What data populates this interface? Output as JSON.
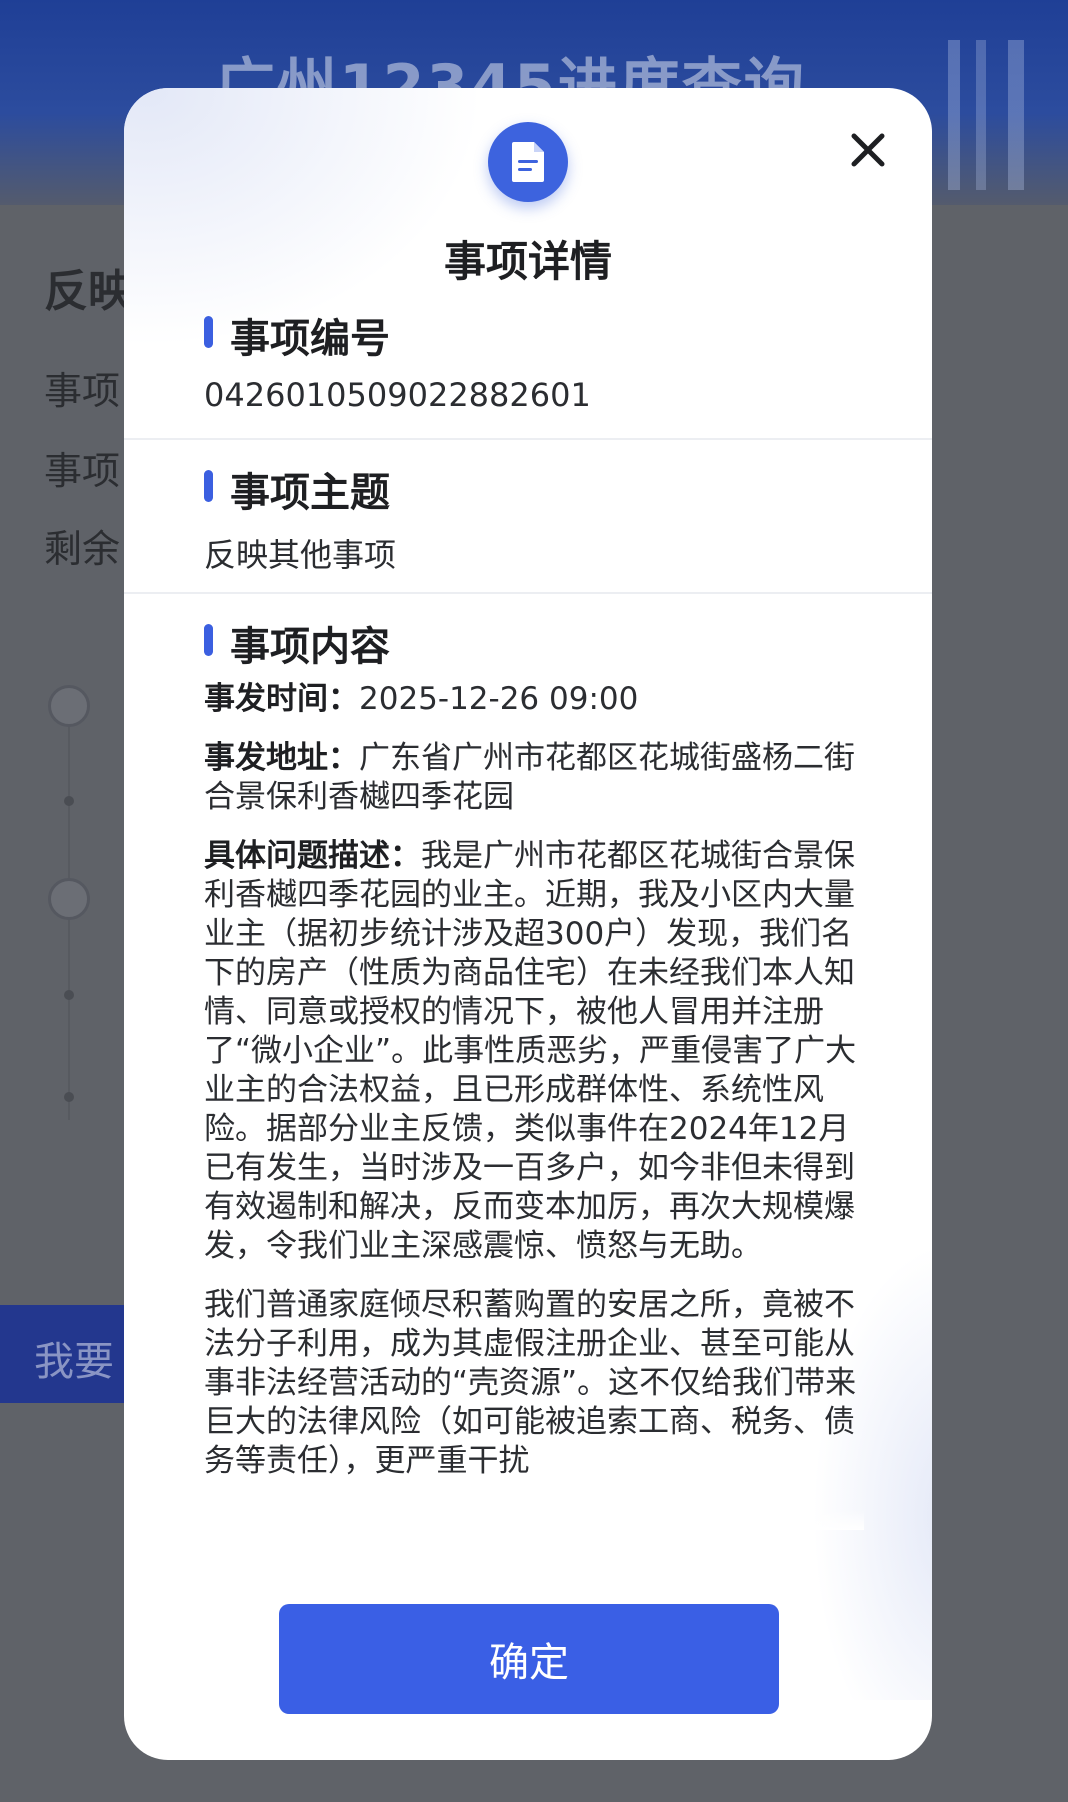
{
  "background": {
    "header_title": "广州12345进度查询",
    "heading": "反映",
    "row1": "事项",
    "row2": "事项",
    "row3": "剩余",
    "button_label": "我要"
  },
  "modal": {
    "title": "事项详情",
    "icon": "document-icon",
    "close_icon": "close-icon",
    "sections": {
      "number": {
        "heading": "事项编号",
        "value": "0426010509022882601"
      },
      "subject": {
        "heading": "事项主题",
        "value": "反映其他事项"
      },
      "content": {
        "heading": "事项内容",
        "time_label": "事发时间：",
        "time_value": "2025-12-26 09:00",
        "address_label": "事发地址：",
        "address_value": "广东省广州市花都区花城街盛杨二街合景保利香樾四季花园",
        "desc_label": "具体问题描述：",
        "desc_value": "我是广州市花都区花城街合景保利香樾四季花园的业主。近期，我及小区内大量业主（据初步统计涉及超300户）发现，我们名下的房产（性质为商品住宅）在未经我们本人知情、同意或授权的情况下，被他人冒用并注册了“微小企业”。此事性质恶劣，严重侵害了广大业主的合法权益，且已形成群体性、系统性风险。据部分业主反馈，类似事件在2024年12月已有发生，当时涉及一百多户，如今非但未得到有效遏制和解决，反而变本加厉，再次大规模爆发，令我们业主深感震惊、愤怒与无助。",
        "paragraph2": "我们普通家庭倾尽积蓄购置的安居之所，竟被不法分子利用，成为其虚假注册企业、甚至可能从事非法经营活动的“壳资源”。这不仅给我们带来巨大的法律风险（如可能被追索工商、税务、债务等责任），更严重干扰"
      }
    },
    "confirm_label": "确定"
  },
  "colors": {
    "accent": "#3a5fe5",
    "header_blue": "#23378e",
    "overlay": "#5f6268"
  }
}
